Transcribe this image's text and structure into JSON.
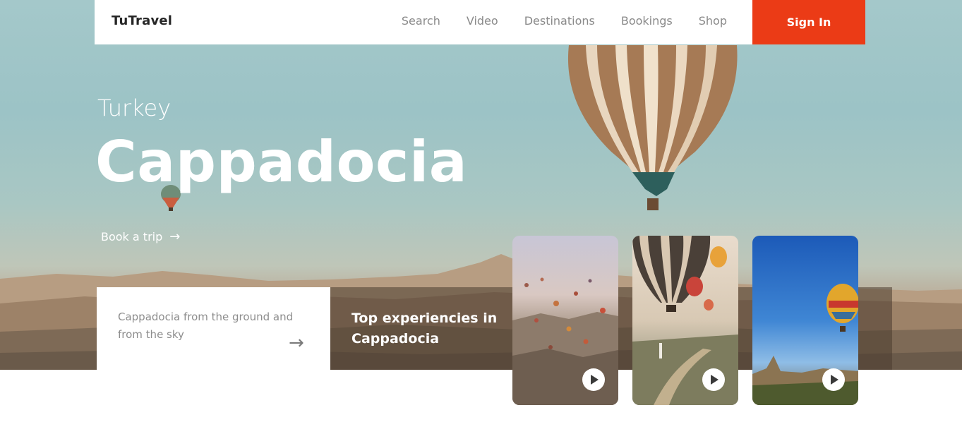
{
  "nav": {
    "logo": "TuTravel",
    "items": [
      "Search",
      "Video",
      "Destinations",
      "Bookings",
      "Shop"
    ],
    "signin_label": "Sign In",
    "accent_color": "#eb3b16"
  },
  "hero": {
    "country": "Turkey",
    "city": "Cappadocia",
    "cta_label": "Book a trip",
    "cta_icon": "arrow-right-icon"
  },
  "info_card": {
    "text": "Cappadocia from the ground and from the sky",
    "icon": "arrow-right-icon"
  },
  "experiences": {
    "title": "Top experiencies in Cappadocia",
    "videos": [
      {
        "icon": "play-icon"
      },
      {
        "icon": "play-icon"
      },
      {
        "icon": "play-icon"
      }
    ]
  }
}
